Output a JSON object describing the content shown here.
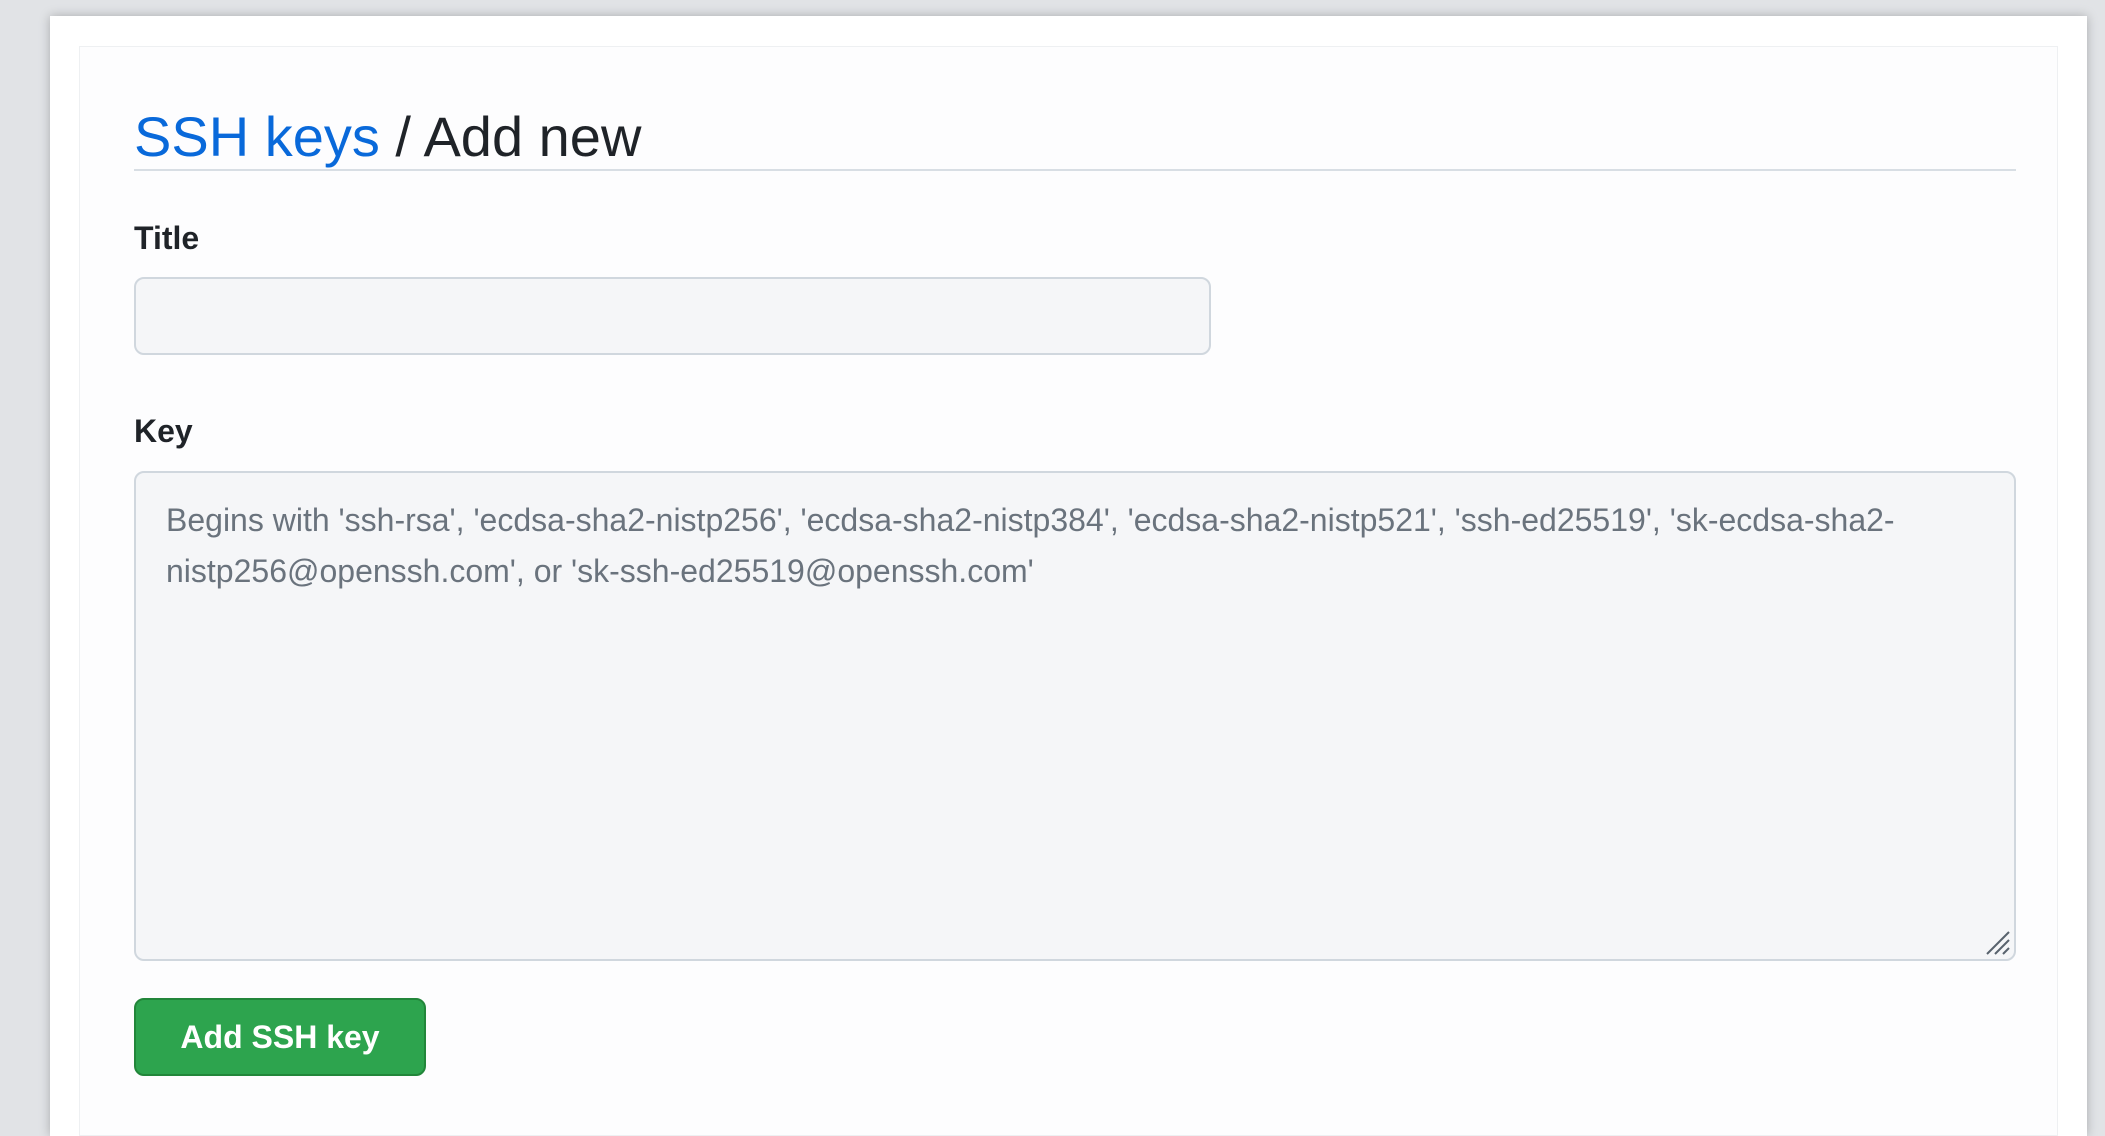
{
  "breadcrumb": {
    "parent": "SSH keys",
    "separator": " / ",
    "current": "Add new"
  },
  "form": {
    "title_label": "Title",
    "title_value": "",
    "key_label": "Key",
    "key_placeholder": "Begins with 'ssh-rsa', 'ecdsa-sha2-nistp256', 'ecdsa-sha2-nistp384', 'ecdsa-sha2-nistp521', 'ssh-ed25519', 'sk-ecdsa-sha2-nistp256@openssh.com', or 'sk-ssh-ed25519@openssh.com'",
    "submit_label": "Add SSH key"
  },
  "colors": {
    "link": "#0969da",
    "primary_button": "#2da44e",
    "input_background": "#f5f6f8"
  },
  "icons": {
    "textarea_resize": "resize-handle-icon"
  }
}
